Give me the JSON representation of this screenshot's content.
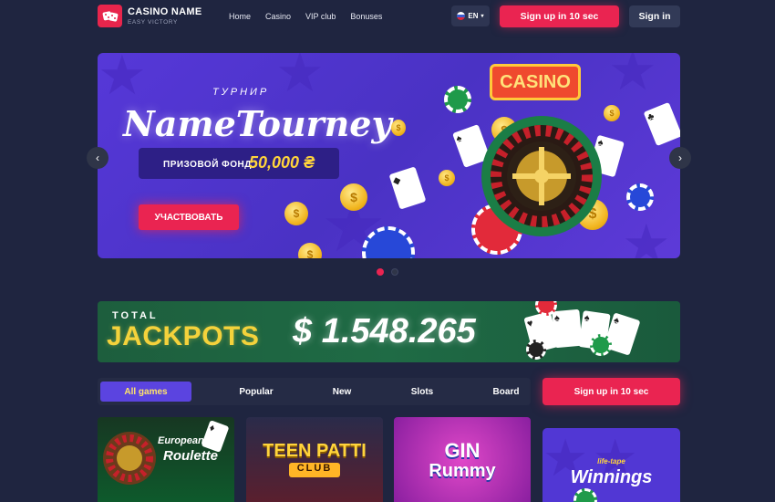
{
  "header": {
    "brand_name": "CASINO NAME",
    "brand_tagline": "EASY VICTORY",
    "nav": [
      "Home",
      "Casino",
      "VIP club",
      "Bonuses"
    ],
    "language": "EN",
    "signup_label": "Sign up in 10 sec",
    "signin_label": "Sign in"
  },
  "banner": {
    "subtitle": "ТУРНИР",
    "title": "NameTourney",
    "prize_label": "ПРИЗОВОЙ ФОНД",
    "prize_value": "50,000 ₴",
    "cta_label": "УЧАСТВОВАТЬ",
    "sign_text": "CASINO",
    "slides_total": 2,
    "active_slide": 1
  },
  "jackpot": {
    "prefix": "TOTAL",
    "label": "JACKPOTS",
    "amount": "$ 1.548.265"
  },
  "games_nav": {
    "tabs": [
      "All games",
      "Popular",
      "New",
      "Slots",
      "Board"
    ],
    "active_tab": "All games",
    "signup_label": "Sign up in 10 sec"
  },
  "games": [
    {
      "line1": "European",
      "line2": "Roulette"
    },
    {
      "line1": "TEEN PATTI",
      "line2": "CLUB"
    },
    {
      "line1": "GIN",
      "line2": "Rummy"
    }
  ],
  "promo": {
    "line1": "life-tape",
    "line2": "Winnings"
  },
  "colors": {
    "background": "#1f2540",
    "accent_red": "#ea2451",
    "banner_purple": "#5638d8",
    "jackpot_green": "#1f6b45",
    "gold": "#f4d23b"
  }
}
